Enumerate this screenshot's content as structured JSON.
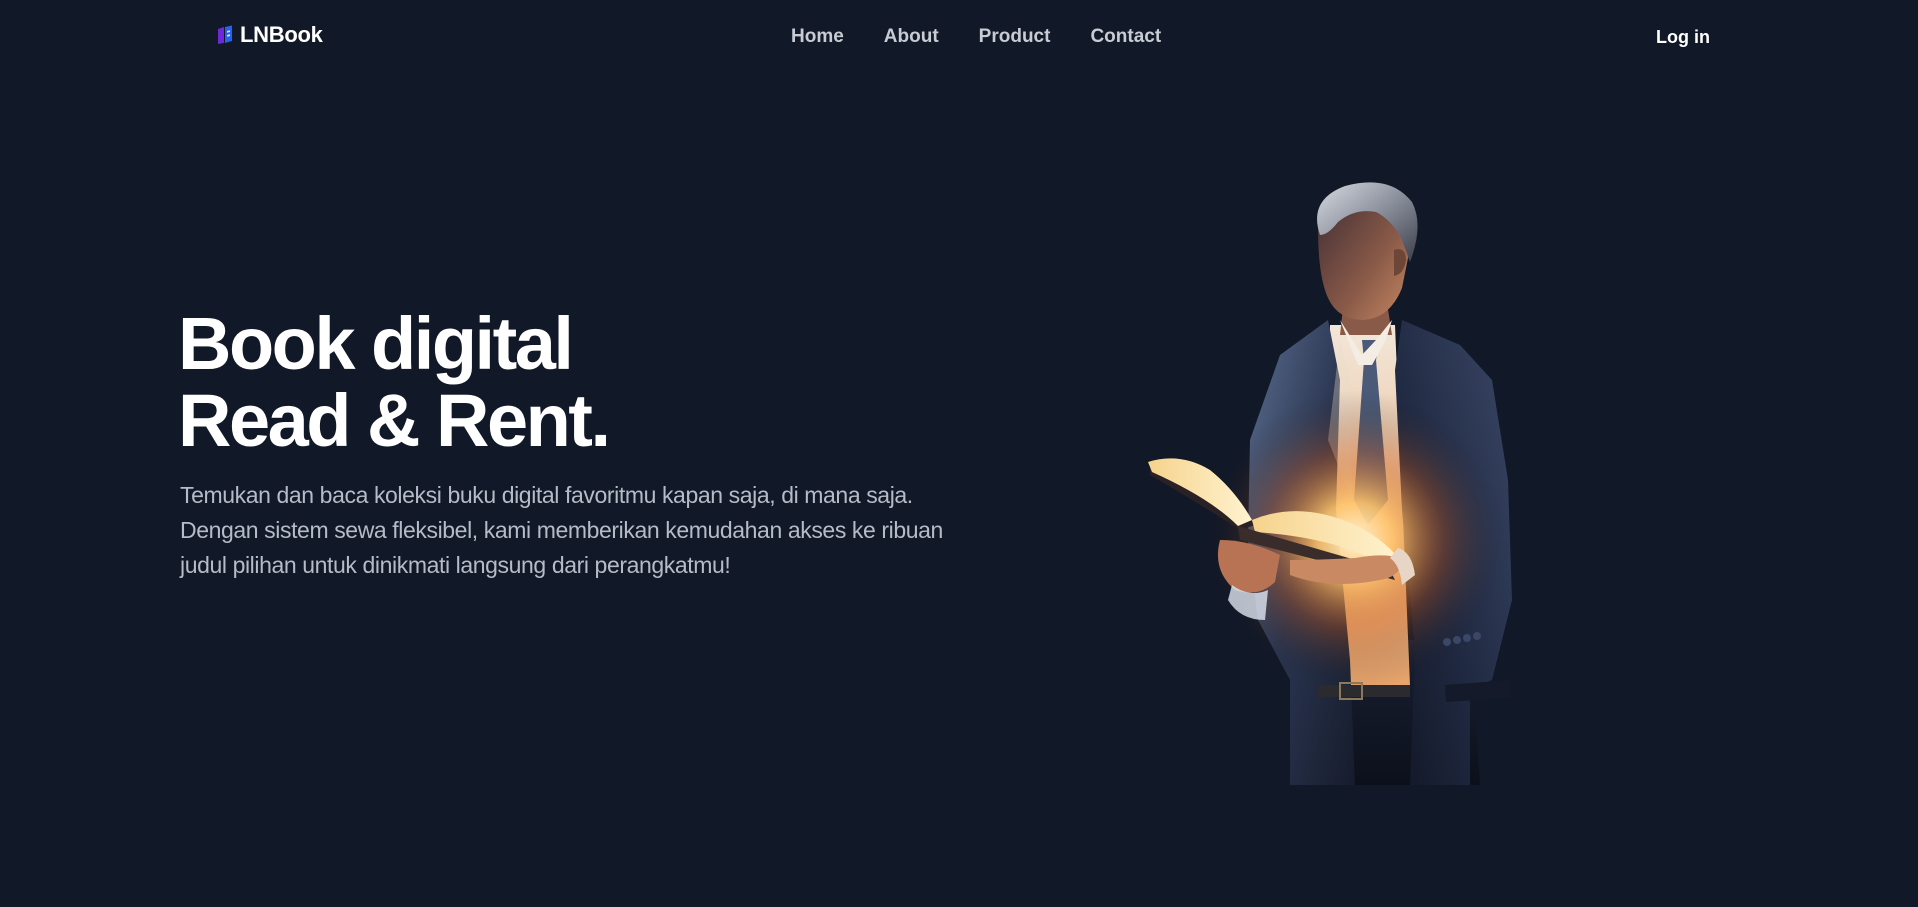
{
  "header": {
    "brand": {
      "name": "LNBook",
      "logo_icon": "book-logo-icon"
    },
    "nav": [
      {
        "label": "Home"
      },
      {
        "label": "About"
      },
      {
        "label": "Product"
      },
      {
        "label": "Contact"
      }
    ],
    "login_label": "Log in"
  },
  "hero": {
    "title_line1": "Book digital",
    "title_line2": "Read & Rent.",
    "description_lines": [
      "Temukan dan baca koleksi buku digital favoritmu kapan saja, di mana saja.",
      "Dengan sistem sewa fleksibel, kami memberikan kemudahan akses ke ribuan",
      "judul pilihan untuk dinikmati langsung dari perangkatmu!"
    ],
    "illustration": "man-reading-glowing-book-illustration"
  },
  "colors": {
    "background": "#111827",
    "text_primary": "#ffffff",
    "text_muted": "#b5bcc7",
    "nav_text": "#c7cbd3",
    "logo_blue": "#3b82f6",
    "logo_purple": "#7c3aed",
    "glow": "#f59e0b"
  }
}
